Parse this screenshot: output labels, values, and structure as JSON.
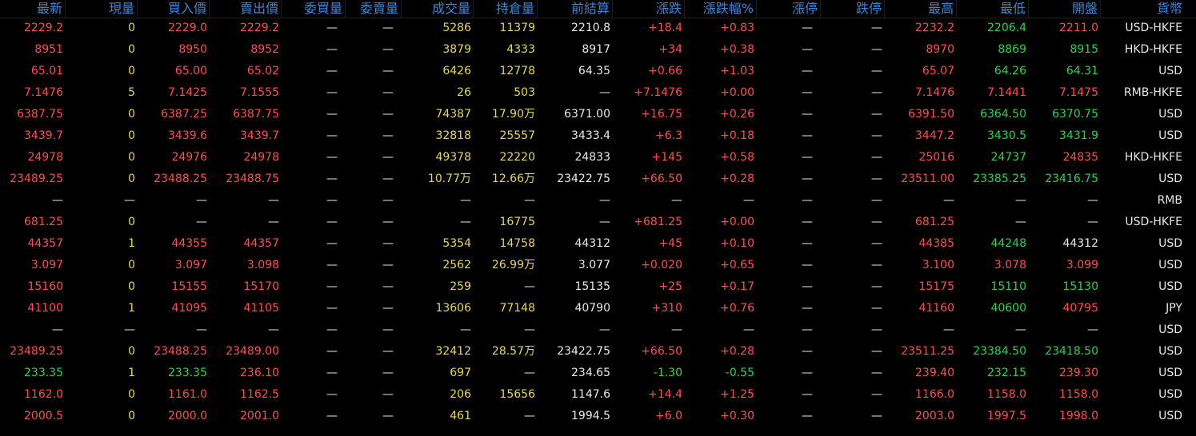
{
  "columns": [
    "最新",
    "現量",
    "買入價",
    "賣出價",
    "委買量",
    "委賣量",
    "成交量",
    "持倉量",
    "前結算",
    "漲跌",
    "漲跌幅%",
    "漲停",
    "跌停",
    "最高",
    "最低",
    "開盤",
    "貨幣"
  ],
  "colors": {
    "header": "#3c86d6",
    "up": "#ff4d4d",
    "down": "#27d44a",
    "neutral": "#e8e8e8",
    "volume": "#e8d84a",
    "background": "#000000"
  },
  "rows": [
    {
      "cells": [
        "2229.2",
        "0",
        "2229.0",
        "2229.2",
        "—",
        "—",
        "5286",
        "11379",
        "2210.8",
        "+18.4",
        "+0.83",
        "—",
        "—",
        "2232.2",
        "2206.4",
        "2211.0",
        "USD-HKFE"
      ],
      "colors": [
        "up",
        "yellow",
        "up",
        "up",
        "dash",
        "dash",
        "yellow",
        "yellow",
        "white",
        "up",
        "up",
        "dash",
        "dash",
        "up",
        "down",
        "up",
        "white"
      ]
    },
    {
      "cells": [
        "8951",
        "0",
        "8950",
        "8952",
        "—",
        "—",
        "3879",
        "4333",
        "8917",
        "+34",
        "+0.38",
        "—",
        "—",
        "8970",
        "8869",
        "8915",
        "HKD-HKFE"
      ],
      "colors": [
        "up",
        "yellow",
        "up",
        "up",
        "dash",
        "dash",
        "yellow",
        "yellow",
        "white",
        "up",
        "up",
        "dash",
        "dash",
        "up",
        "down",
        "down",
        "white"
      ]
    },
    {
      "cells": [
        "65.01",
        "0",
        "65.00",
        "65.02",
        "—",
        "—",
        "6426",
        "12778",
        "64.35",
        "+0.66",
        "+1.03",
        "—",
        "—",
        "65.07",
        "64.26",
        "64.31",
        "USD"
      ],
      "colors": [
        "up",
        "yellow",
        "up",
        "up",
        "dash",
        "dash",
        "yellow",
        "yellow",
        "white",
        "up",
        "up",
        "dash",
        "dash",
        "up",
        "down",
        "down",
        "white"
      ]
    },
    {
      "cells": [
        "7.1476",
        "5",
        "7.1425",
        "7.1555",
        "—",
        "—",
        "26",
        "503",
        "—",
        "+7.1476",
        "+0.00",
        "—",
        "—",
        "7.1476",
        "7.1441",
        "7.1475",
        "RMB-HKFE"
      ],
      "colors": [
        "up",
        "yellow",
        "up",
        "up",
        "dash",
        "dash",
        "yellow",
        "yellow",
        "white",
        "up",
        "up",
        "dash",
        "dash",
        "up",
        "up",
        "up",
        "white"
      ]
    },
    {
      "cells": [
        "6387.75",
        "0",
        "6387.25",
        "6387.75",
        "—",
        "—",
        "74387",
        "17.90万",
        "6371.00",
        "+16.75",
        "+0.26",
        "—",
        "—",
        "6391.50",
        "6364.50",
        "6370.75",
        "USD"
      ],
      "colors": [
        "up",
        "yellow",
        "up",
        "up",
        "dash",
        "dash",
        "yellow",
        "yellow",
        "white",
        "up",
        "up",
        "dash",
        "dash",
        "up",
        "down",
        "down",
        "white"
      ]
    },
    {
      "cells": [
        "3439.7",
        "0",
        "3439.6",
        "3439.7",
        "—",
        "—",
        "32818",
        "25557",
        "3433.4",
        "+6.3",
        "+0.18",
        "—",
        "—",
        "3447.2",
        "3430.5",
        "3431.9",
        "USD"
      ],
      "colors": [
        "up",
        "yellow",
        "up",
        "up",
        "dash",
        "dash",
        "yellow",
        "yellow",
        "white",
        "up",
        "up",
        "dash",
        "dash",
        "up",
        "down",
        "down",
        "white"
      ]
    },
    {
      "cells": [
        "24978",
        "0",
        "24976",
        "24978",
        "—",
        "—",
        "49378",
        "22220",
        "24833",
        "+145",
        "+0.58",
        "—",
        "—",
        "25016",
        "24737",
        "24835",
        "HKD-HKFE"
      ],
      "colors": [
        "up",
        "yellow",
        "up",
        "up",
        "dash",
        "dash",
        "yellow",
        "yellow",
        "white",
        "up",
        "up",
        "dash",
        "dash",
        "up",
        "down",
        "up",
        "white"
      ]
    },
    {
      "cells": [
        "23489.25",
        "0",
        "23488.25",
        "23488.75",
        "—",
        "—",
        "10.77万",
        "12.66万",
        "23422.75",
        "+66.50",
        "+0.28",
        "—",
        "—",
        "23511.00",
        "23385.25",
        "23416.75",
        "USD"
      ],
      "colors": [
        "up",
        "yellow",
        "up",
        "up",
        "dash",
        "dash",
        "yellow",
        "yellow",
        "white",
        "up",
        "up",
        "dash",
        "dash",
        "up",
        "down",
        "down",
        "white"
      ]
    },
    {
      "cells": [
        "—",
        "—",
        "—",
        "—",
        "—",
        "—",
        "—",
        "—",
        "—",
        "—",
        "—",
        "—",
        "—",
        "—",
        "—",
        "—",
        "RMB"
      ],
      "colors": [
        "dash",
        "dash",
        "dash",
        "dash",
        "dash",
        "dash",
        "dash",
        "dash",
        "dash",
        "dash",
        "dash",
        "dash",
        "dash",
        "dash",
        "dash",
        "dash",
        "white"
      ]
    },
    {
      "cells": [
        "681.25",
        "0",
        "—",
        "—",
        "—",
        "—",
        "—",
        "16775",
        "—",
        "+681.25",
        "+0.00",
        "—",
        "—",
        "681.25",
        "—",
        "—",
        "USD-HKFE"
      ],
      "colors": [
        "up",
        "yellow",
        "dash",
        "dash",
        "dash",
        "dash",
        "dash",
        "yellow",
        "white",
        "up",
        "up",
        "dash",
        "dash",
        "up",
        "dash",
        "dash",
        "white"
      ]
    },
    {
      "cells": [
        "44357",
        "1",
        "44355",
        "44357",
        "—",
        "—",
        "5354",
        "14758",
        "44312",
        "+45",
        "+0.10",
        "—",
        "—",
        "44385",
        "44248",
        "44312",
        "USD"
      ],
      "colors": [
        "up",
        "yellow",
        "up",
        "up",
        "dash",
        "dash",
        "yellow",
        "yellow",
        "white",
        "up",
        "up",
        "dash",
        "dash",
        "up",
        "down",
        "white",
        "white"
      ]
    },
    {
      "cells": [
        "3.097",
        "0",
        "3.097",
        "3.098",
        "—",
        "—",
        "2562",
        "26.99万",
        "3.077",
        "+0.020",
        "+0.65",
        "—",
        "—",
        "3.100",
        "3.078",
        "3.099",
        "USD"
      ],
      "colors": [
        "up",
        "yellow",
        "up",
        "up",
        "dash",
        "dash",
        "yellow",
        "yellow",
        "white",
        "up",
        "up",
        "dash",
        "dash",
        "up",
        "up",
        "up",
        "white"
      ]
    },
    {
      "cells": [
        "15160",
        "0",
        "15155",
        "15170",
        "—",
        "—",
        "259",
        "—",
        "15135",
        "+25",
        "+0.17",
        "—",
        "—",
        "15175",
        "15110",
        "15130",
        "USD"
      ],
      "colors": [
        "up",
        "yellow",
        "up",
        "up",
        "dash",
        "dash",
        "yellow",
        "dash",
        "white",
        "up",
        "up",
        "dash",
        "dash",
        "up",
        "down",
        "down",
        "white"
      ]
    },
    {
      "cells": [
        "41100",
        "1",
        "41095",
        "41105",
        "—",
        "—",
        "13606",
        "77148",
        "40790",
        "+310",
        "+0.76",
        "—",
        "—",
        "41160",
        "40600",
        "40795",
        "JPY"
      ],
      "colors": [
        "up",
        "yellow",
        "up",
        "up",
        "dash",
        "dash",
        "yellow",
        "yellow",
        "white",
        "up",
        "up",
        "dash",
        "dash",
        "up",
        "down",
        "up",
        "white"
      ]
    },
    {
      "cells": [
        "—",
        "—",
        "—",
        "—",
        "—",
        "—",
        "—",
        "—",
        "—",
        "—",
        "—",
        "—",
        "—",
        "—",
        "—",
        "—",
        "USD"
      ],
      "colors": [
        "dash",
        "dash",
        "dash",
        "dash",
        "dash",
        "dash",
        "dash",
        "dash",
        "dash",
        "dash",
        "dash",
        "dash",
        "dash",
        "dash",
        "dash",
        "dash",
        "white"
      ]
    },
    {
      "cells": [
        "23489.25",
        "0",
        "23488.25",
        "23489.00",
        "—",
        "—",
        "32412",
        "28.57万",
        "23422.75",
        "+66.50",
        "+0.28",
        "—",
        "—",
        "23511.25",
        "23384.50",
        "23418.50",
        "USD"
      ],
      "colors": [
        "up",
        "yellow",
        "up",
        "up",
        "dash",
        "dash",
        "yellow",
        "yellow",
        "white",
        "up",
        "up",
        "dash",
        "dash",
        "up",
        "down",
        "down",
        "white"
      ]
    },
    {
      "cells": [
        "233.35",
        "1",
        "233.35",
        "236.10",
        "—",
        "—",
        "697",
        "—",
        "234.65",
        "-1.30",
        "-0.55",
        "—",
        "—",
        "239.40",
        "232.15",
        "239.30",
        "USD"
      ],
      "colors": [
        "down",
        "yellow",
        "down",
        "up",
        "dash",
        "dash",
        "yellow",
        "dash",
        "white",
        "down",
        "down",
        "dash",
        "dash",
        "up",
        "down",
        "up",
        "white"
      ]
    },
    {
      "cells": [
        "1162.0",
        "0",
        "1161.0",
        "1162.5",
        "—",
        "—",
        "206",
        "15656",
        "1147.6",
        "+14.4",
        "+1.25",
        "—",
        "—",
        "1166.0",
        "1158.0",
        "1158.0",
        "USD"
      ],
      "colors": [
        "up",
        "yellow",
        "up",
        "up",
        "dash",
        "dash",
        "yellow",
        "yellow",
        "white",
        "up",
        "up",
        "dash",
        "dash",
        "up",
        "up",
        "up",
        "white"
      ]
    },
    {
      "cells": [
        "2000.5",
        "0",
        "2000.0",
        "2001.0",
        "—",
        "—",
        "461",
        "—",
        "1994.5",
        "+6.0",
        "+0.30",
        "—",
        "—",
        "2003.0",
        "1997.5",
        "1998.0",
        "USD"
      ],
      "colors": [
        "up",
        "yellow",
        "up",
        "up",
        "dash",
        "dash",
        "yellow",
        "dash",
        "white",
        "up",
        "up",
        "dash",
        "dash",
        "up",
        "up",
        "up",
        "white"
      ]
    }
  ]
}
